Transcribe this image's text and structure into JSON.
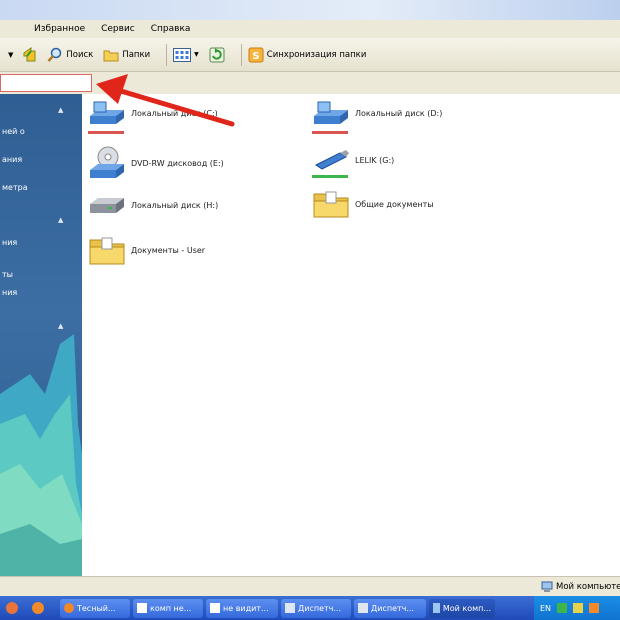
{
  "menu": [
    "Избранное",
    "Сервис",
    "Справка"
  ],
  "toolbar": {
    "search": "Поиск",
    "folders": "Папки",
    "sync": "Синхронизация папки"
  },
  "tasks": [
    "ней о",
    "ания",
    "метра",
    "ния",
    "ты",
    "ния"
  ],
  "drives": [
    {
      "label": "Локальный диск (C:)",
      "icon": "hard-drive-icon"
    },
    {
      "label": "Локальный диск (D:)",
      "icon": "hard-drive-icon"
    },
    {
      "label": "DVD-RW дисковод (E:)",
      "icon": "dvd-drive-icon"
    },
    {
      "label": "LELIK (G:)",
      "icon": "usb-drive-icon"
    },
    {
      "label": "Локальный диск (H:)",
      "icon": "hard-drive-icon"
    },
    {
      "label": "Общие документы",
      "icon": "folder-icon"
    },
    {
      "label": "Документы - User",
      "icon": "folder-icon"
    }
  ],
  "status": {
    "text": "Мой компьютер"
  },
  "taskbar": {
    "buttons": [
      "Тесный...",
      "комп не...",
      "не видит...",
      "Диспетч...",
      "Диспетч...",
      "Мой комп..."
    ],
    "lang": "EN"
  },
  "colors": {
    "drive_used_bar": "#d9534f",
    "usb_used_bar": "#3cb54a",
    "annotation_arrow": "#e0261b"
  }
}
